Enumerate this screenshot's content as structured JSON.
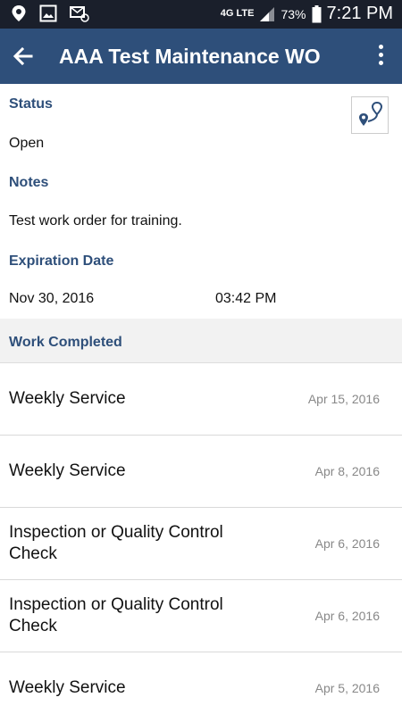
{
  "status_bar": {
    "network": "4G LTE",
    "battery": "73%",
    "time": "7:21 PM"
  },
  "app_bar": {
    "title": "AAA Test Maintenance WO"
  },
  "details": {
    "status_label": "Status",
    "status_value": "Open",
    "notes_label": "Notes",
    "notes_value": "Test work order for training.",
    "expiration_label": "Expiration Date",
    "expiration_date": "Nov 30, 2016",
    "expiration_time": "03:42 PM"
  },
  "work_completed": {
    "header": "Work Completed",
    "items": [
      {
        "name": "Weekly Service",
        "date": "Apr 15, 2016"
      },
      {
        "name": "Weekly Service",
        "date": "Apr 8, 2016"
      },
      {
        "name": "Inspection or Quality Control Check",
        "date": "Apr 6, 2016"
      },
      {
        "name": "Inspection or Quality Control Check",
        "date": "Apr 6, 2016"
      },
      {
        "name": "Weekly Service",
        "date": "Apr 5, 2016"
      }
    ]
  },
  "icons": {
    "back": "arrow-left-icon",
    "more": "more-vertical-icon",
    "route": "route-pin-icon",
    "colors": {
      "app_bar": "#2e4f7a",
      "label": "#2e4f7a",
      "status_bar": "#1a1f2b"
    }
  }
}
